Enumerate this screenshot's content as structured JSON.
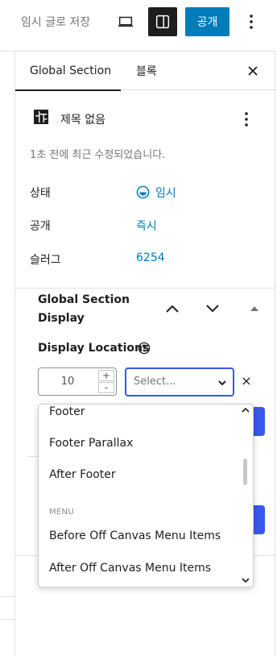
{
  "toolbar": {
    "save_draft": "임시 글로 저장",
    "publish": "공개"
  },
  "tabs": {
    "document": "Global Section",
    "block": "블록"
  },
  "summary": {
    "title": "제목 없음",
    "modified": "1초 전에 최근 수정되었습니다.",
    "rows": [
      {
        "label": "상태",
        "value": "임시"
      },
      {
        "label": "공개",
        "value": "즉시"
      },
      {
        "label": "슬러그",
        "value": "6254"
      }
    ]
  },
  "panel": {
    "title": "Global Section Display",
    "locations_label": "Display Locations",
    "priority_value": "10",
    "increment": "+",
    "decrement": "-",
    "select_placeholder": "Select...",
    "remove": "×"
  },
  "dropdown": {
    "items": [
      "Footer",
      "Footer Parallax",
      "After Footer"
    ],
    "group_label": "MENU",
    "group_items": [
      "Before Off Canvas Menu Items",
      "After Off Canvas Menu Items"
    ]
  },
  "colors": {
    "accent": "#007cba",
    "focus": "#3858e9",
    "text": "#1e1e1e"
  }
}
